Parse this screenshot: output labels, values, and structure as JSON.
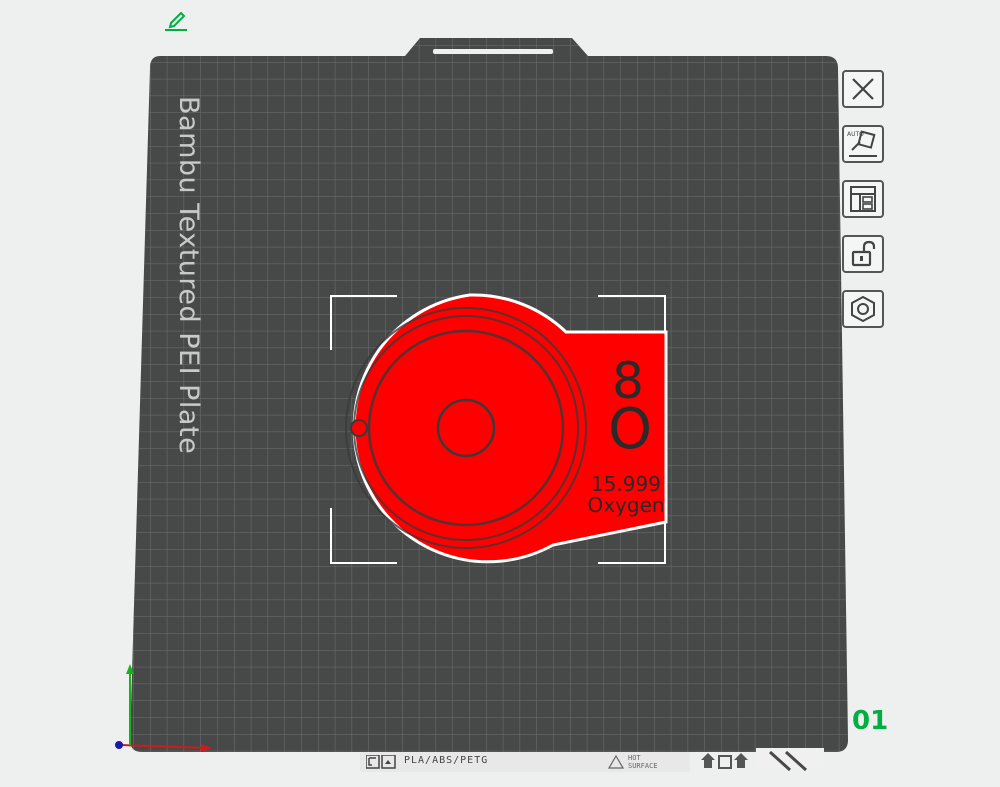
{
  "header": {
    "edit_icon": "pencil-icon"
  },
  "plate": {
    "name": "Bambu Textured PEI Plate",
    "number": "01",
    "filament_types": "PLA/ABS/PETG",
    "hot_surface_warning": "HOT\nSURFACE"
  },
  "toolbar": {
    "items": [
      {
        "name": "close-plate-button",
        "icon": "close-icon"
      },
      {
        "name": "auto-orient-button",
        "icon": "auto-orient-icon",
        "badge": "AUTO"
      },
      {
        "name": "arrange-button",
        "icon": "arrange-icon"
      },
      {
        "name": "lock-plate-button",
        "icon": "unlock-icon"
      },
      {
        "name": "plate-settings-button",
        "icon": "hexagon-settings-icon"
      }
    ]
  },
  "model": {
    "atomic_number": "8",
    "symbol": "O",
    "atomic_mass": "15.999",
    "element_name": "Oxygen",
    "color": "#ff0000"
  },
  "colors": {
    "background": "#eeefef",
    "plate": "#474948",
    "grid": "#6f7170",
    "accent_green": "#00ae42",
    "axis_x": "#d11a1a",
    "axis_y": "#19b219",
    "axis_z": "#1a1aa8"
  }
}
